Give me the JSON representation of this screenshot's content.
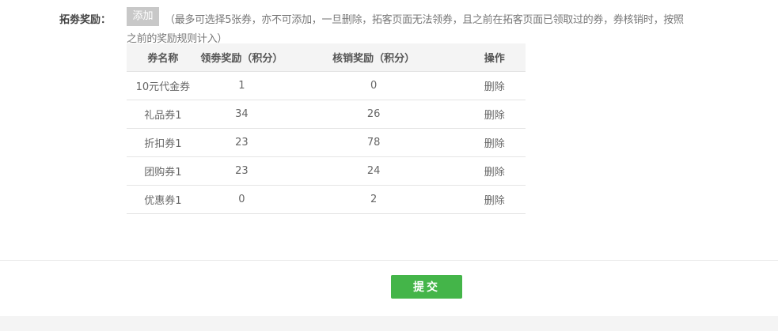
{
  "form": {
    "label": "拓劵奖励：",
    "add_button": "添加",
    "hint_line1": "（最多可选择5张券，亦不可添加，一旦删除，拓客页面无法领券，且之前在拓客页面已领取过的券，券核销时，按照",
    "hint_line2": "之前的奖励规则计入）"
  },
  "table": {
    "headers": [
      "券名称",
      "领劵奖励（积分）",
      "核销奖励（积分）",
      "操作"
    ],
    "rows": [
      {
        "name": "10元代金券",
        "get_reward": "1",
        "verify_reward": "0",
        "action": "删除"
      },
      {
        "name": "礼品券1",
        "get_reward": "34",
        "verify_reward": "26",
        "action": "删除"
      },
      {
        "name": "折扣券1",
        "get_reward": "23",
        "verify_reward": "78",
        "action": "删除"
      },
      {
        "name": "团购券1",
        "get_reward": "23",
        "verify_reward": "24",
        "action": "删除"
      },
      {
        "name": "优惠券1",
        "get_reward": "0",
        "verify_reward": "2",
        "action": "删除"
      }
    ]
  },
  "footer": {
    "submit_label": "提交"
  },
  "colors": {
    "submit_bg": "#44b549",
    "add_bg": "#c8c8c8",
    "header_bg": "#f4f4f4"
  }
}
